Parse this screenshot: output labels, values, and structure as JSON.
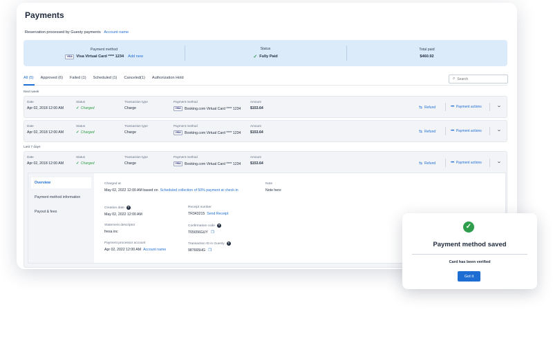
{
  "page": {
    "title": "Payments",
    "subline_text": "Reservation processed by Guesty payments",
    "subline_link": "Account name"
  },
  "summary": {
    "payment_method_label": "Payment method",
    "payment_method_value": "Visa Virtual Card **** 1234",
    "add_new": "Add new",
    "status_label": "Status",
    "status_value": "Fully Paid",
    "total_label": "Total paid",
    "total_value": "$460.92"
  },
  "tabs": [
    {
      "label": "All (5)"
    },
    {
      "label": "Approved (6)"
    },
    {
      "label": "Failed (1)"
    },
    {
      "label": "Scheduled (1)"
    },
    {
      "label": "Canceled(1)"
    },
    {
      "label": "Authorization Hold"
    }
  ],
  "search": {
    "placeholder": "Search"
  },
  "groups": {
    "next_week": "Next week",
    "last_7_days": "Last 7 days"
  },
  "columns": {
    "date": "Date",
    "status": "Status",
    "type": "Transaction type",
    "method": "Payment method",
    "amount": "Amount"
  },
  "rows": [
    {
      "date": "Apr 02, 2018 12:00 AM",
      "status": "Charged",
      "type": "Charge",
      "method": "Booking.com Virtual Card **** 1234",
      "amount": "$153.64"
    },
    {
      "date": "Apr 02, 2018 12:00 AM",
      "status": "Charged",
      "type": "Charge",
      "method": "Booking.com Virtual Card **** 1234",
      "amount": "$153.64"
    },
    {
      "date": "Apr 02, 2018 12:00 AM",
      "status": "Charged",
      "type": "Charge",
      "method": "Booking.com Virtual Card **** 1234",
      "amount": "$153.64"
    }
  ],
  "row_actions": {
    "refund": "Refund",
    "payment_actions": "Payment actions"
  },
  "card_brand": "VISA",
  "detail": {
    "nav": [
      {
        "label": "Overview"
      },
      {
        "label": "Payment method information"
      },
      {
        "label": "Payout & fees"
      }
    ],
    "charged_at_label": "Charged at",
    "charged_at_text": "May 02, 2022 12:00 AM based on",
    "charged_at_link": "Scheduled collection of 50% payment at check-in",
    "note_label": "Note",
    "note_value": "Note here",
    "creation_label": "Creation date",
    "creation_value": "May 02, 2022 12:00 AM",
    "receipt_label": "Receipt number",
    "receipt_value": "TR343215",
    "send_receipt": "Send Receipt",
    "descriptor_label": "Statement descriptor",
    "descriptor_value": "fresa inc",
    "confirmation_label": "Confirmation code",
    "confirmation_value": "T65656GUY",
    "processor_label": "Payment processor account",
    "processor_value": "Apr 02, 2022 12:00 AM",
    "processor_link": "Account name",
    "txn_label": "Transaction ID in Guesty",
    "txn_value": "987665HG"
  },
  "modal": {
    "title": "Payment method saved",
    "subtitle": "Card has been verified",
    "button": "Got it"
  },
  "icons": {
    "check": "check-icon",
    "search": "search-icon",
    "refund": "refund-icon",
    "dots": "dots-icon",
    "chevron": "chevron-down-icon",
    "info": "info-icon",
    "copy": "copy-icon"
  },
  "colors": {
    "accent": "#1e6dd3",
    "success": "#2e9d4a",
    "summary_bg": "#dcebfa"
  }
}
